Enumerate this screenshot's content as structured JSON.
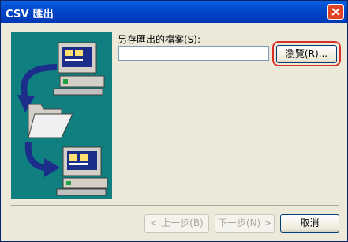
{
  "window": {
    "title": "CSV 匯出"
  },
  "form": {
    "save_as_label": "另存匯出的檔案(S):",
    "file_value": "",
    "browse_label": "瀏覽(R)..."
  },
  "buttons": {
    "back_label": "< 上一步(B)",
    "next_label": "下一步(N) >",
    "cancel_label": "取消"
  },
  "colors": {
    "panel": "#0f7f80",
    "titlebar": "#0046c8",
    "highlight": "#d9302a"
  }
}
